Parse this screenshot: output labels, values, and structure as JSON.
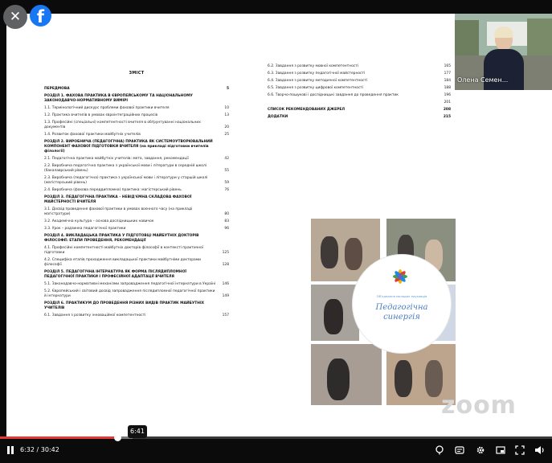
{
  "overlay": {
    "close_label": "✕",
    "facebook_label": "f"
  },
  "document": {
    "toc_title": "ЗМІСТ",
    "left_entries": [
      {
        "text": "ПЕРЕДМОВА",
        "page": "5",
        "kind": "section"
      },
      {
        "text": "РОЗДІЛ 1. ФАХОВА ПРАКТИКА В ЄВРОПЕЙСЬКОМУ ТА НАЦІОНАЛЬНОМУ ЗАКОНОДАВЧО-НОРМАТИВНОМУ ВИМІРІ",
        "page": "",
        "kind": "section"
      },
      {
        "text": "1.1. Термінологічний дискурс проблеми фахової практики вчителя",
        "page": "10",
        "kind": "sub"
      },
      {
        "text": "1.2. Практика вчителів в умовах євроінтеграційних процесів",
        "page": "13",
        "kind": "sub"
      },
      {
        "text": "1.3. Професійні (спеціальні) компетентності вчителя в обґрунтуванні національних документів",
        "page": "20",
        "kind": "sub"
      },
      {
        "text": "1.4. Розвиток фахової практики майбутніх учителів",
        "page": "25",
        "kind": "sub"
      },
      {
        "text": "РОЗДІЛ 2. ВИРОБНИЧА (ПЕДАГОГІЧНА) ПРАКТИКА ЯК СИСТЕМОУТВОРЮВАЛЬНИЙ КОМПОНЕНТ ФАХОВОЇ ПІДГОТОВКИ ВЧИТЕЛЯ (на прикладі підготовки вчителів філології)",
        "page": "",
        "kind": "section"
      },
      {
        "text": "2.1. Педагогічна практика майбутніх учителів: мета, завдання, рекомендації",
        "page": "42",
        "kind": "sub"
      },
      {
        "text": "2.2. Виробнича педагогічна практика з української мови і літератури в середній школі (бакалаврський рівень)",
        "page": "55",
        "kind": "sub"
      },
      {
        "text": "2.3. Виробнича (педагогічна) практика з української мови і літератури у старшій школі (магістерський рівень)",
        "page": "59",
        "kind": "sub"
      },
      {
        "text": "2.4. Виробнича (фахова переддипломна) практика: магістерський рівень",
        "page": "76",
        "kind": "sub"
      },
      {
        "text": "РОЗДІЛ 3. ПЕДАГОГІЧНА ПРАКТИКА – НЕВІД'ЄМНА СКЛАДОВА ФАХОВОЇ МАЙСТЕРНОСТІ ВЧИТЕЛЯ",
        "page": "",
        "kind": "section"
      },
      {
        "text": "3.1. Досвід проведення фахової практики в умовах воєнного часу (на прикладі магістратури)",
        "page": "80",
        "kind": "sub"
      },
      {
        "text": "3.2. Академічна культура – основа дослідницьких навичок",
        "page": "83",
        "kind": "sub"
      },
      {
        "text": "3.3. Урок – родзинка педагогічної практики",
        "page": "96",
        "kind": "sub"
      },
      {
        "text": "РОЗДІЛ 4. ВИКЛАДАЦЬКА ПРАКТИКА У ПІДГОТОВЦІ МАЙБУТНІХ ДОКТОРІВ ФІЛОСОФІЇ: ЕТАПИ ПРОВЕДЕННЯ, РЕКОМЕНДАЦІЇ",
        "page": "",
        "kind": "section"
      },
      {
        "text": "4.1. Професійні компетентності майбутніх докторів філософії в контексті практичної підготовки",
        "page": "125",
        "kind": "sub"
      },
      {
        "text": "4.2. Специфіка етапів проходження викладацької практики майбутніми докторами філософії",
        "page": "128",
        "kind": "sub"
      },
      {
        "text": "РОЗДІЛ 5. ПЕДАГОГІЧНА ІНТЕРНАТУРА ЯК ФОРМА ПІСЛЯДИПЛОМНОЇ ПЕДАГОГІЧНОЇ ПРАКТИКИ І ПРОФЕСІЙНОЇ АДАПТАЦІЇ ВЧИТЕЛЯ",
        "page": "",
        "kind": "section"
      },
      {
        "text": "5.1. Законодавчо-нормативні механізми запровадження педагогічної інтернатури в Україні",
        "page": "146",
        "kind": "sub"
      },
      {
        "text": "5.2. Європейський і світовий досвід запровадження післядипломної педагогічної практики й інтернатури",
        "page": "149",
        "kind": "sub"
      },
      {
        "text": "РОЗДІЛ 6. ПРАКТИКУМ ДО ПРОВЕДЕННЯ РІЗНИХ ВИДІВ ПРАКТИК МАЙБУТНІХ УЧИТЕЛІВ",
        "page": "",
        "kind": "section"
      },
      {
        "text": "6.1. Завдання з розвитку інноваційної компетентності",
        "page": "157",
        "kind": "sub"
      }
    ],
    "right_entries": [
      {
        "text": "6.2. Завдання з розвитку мовної компетентності",
        "page": "165",
        "kind": "sub"
      },
      {
        "text": "6.3. Завдання з розвитку педагогічної майстерності",
        "page": "177",
        "kind": "sub"
      },
      {
        "text": "6.4. Завдання з розвитку методичної компетентності",
        "page": "184",
        "kind": "sub"
      },
      {
        "text": "6.5. Завдання з розвитку цифрової компетентності",
        "page": "188",
        "kind": "sub"
      },
      {
        "text": "6.6. Творчо-пошукові і дослідницькі завдання до проведення практик",
        "page": "196",
        "kind": "sub"
      },
      {
        "text": "",
        "page": "201",
        "kind": "sub"
      },
      {
        "text": "СПИСОК РЕКОМЕНДОВАНИХ ДЖЕРЕЛ",
        "page": "208",
        "kind": "section"
      },
      {
        "text": "ДОДАТКИ",
        "page": "215",
        "kind": "section"
      }
    ]
  },
  "logo": {
    "small_text": "Обʼєднання молодих науковців",
    "title_line1": "Педагогічна",
    "title_line2": "синергія"
  },
  "watermark": "zoom",
  "speaker": {
    "name": "Олена Семен..."
  },
  "player": {
    "current_time": "6:32",
    "duration": "30:42",
    "hover_time": "6:41",
    "progress_fraction": 0.213,
    "buffer_fraction": 0.24
  },
  "colors": {
    "facebook": "#1877f2",
    "progress": "#e53935",
    "logo_text": "#4a7ec4"
  }
}
